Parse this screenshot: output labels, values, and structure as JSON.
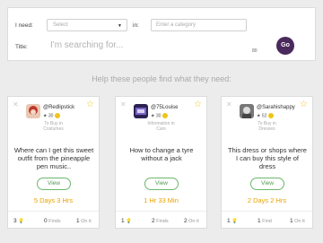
{
  "search": {
    "need_label": "I need:",
    "select_placeholder": "Select",
    "in_label": "in:",
    "category_placeholder": "Enter a category",
    "title_label": "Title:",
    "title_placeholder": "I'm searching for...",
    "char_count": "80",
    "go_label": "Go"
  },
  "help_heading": "Help these people find what they need:",
  "cards": [
    {
      "username": "@Redlipstick",
      "rating": "★ 30",
      "subtitle_line1": "To Buy in",
      "subtitle_line2": "Costumes",
      "request": "Where can I get this sweet outfit from the pineapple pen music..",
      "view_label": "View",
      "time": "5 Days 3 Hrs",
      "footer": [
        {
          "count": "3",
          "label": "",
          "icon": "bulb-icon"
        },
        {
          "count": "0",
          "label": "Finds",
          "icon": ""
        },
        {
          "count": "1",
          "label": "On it",
          "icon": ""
        }
      ]
    },
    {
      "username": "@75Louise",
      "rating": "★ 30",
      "subtitle_line1": "Information in",
      "subtitle_line2": "Cars",
      "request": "How to change a tyre without a jack",
      "view_label": "View",
      "time": "1 Hr 33 Min",
      "footer": [
        {
          "count": "1",
          "label": "",
          "icon": "bulb-icon"
        },
        {
          "count": "2",
          "label": "Finds",
          "icon": ""
        },
        {
          "count": "2",
          "label": "On it",
          "icon": ""
        }
      ]
    },
    {
      "username": "@Sarahishappy",
      "rating": "★ 52",
      "subtitle_line1": "To Buy in",
      "subtitle_line2": "Dresses",
      "request": "This dress or shops where I can buy this style of dress",
      "view_label": "View",
      "time": "2 Days 2 Hrs",
      "footer": [
        {
          "count": "1",
          "label": "",
          "icon": "bulb-icon"
        },
        {
          "count": "1",
          "label": "Find",
          "icon": ""
        },
        {
          "count": "1",
          "label": "On it",
          "icon": ""
        }
      ]
    }
  ],
  "colors": {
    "go_button": "#4a2a5c",
    "time_text": "#e8a200",
    "view_border": "#6cb76c",
    "star": "#f0c419"
  }
}
